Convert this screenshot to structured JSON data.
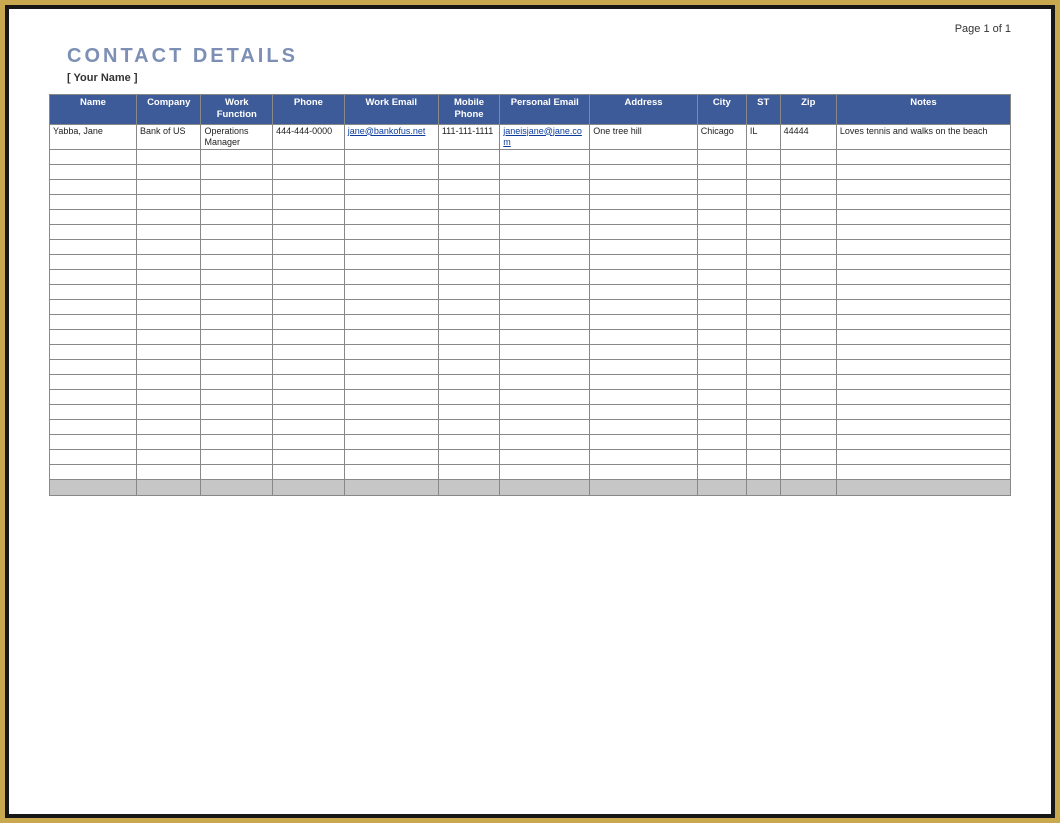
{
  "page_label": "Page 1 of 1",
  "title": "CONTACT DETAILS",
  "subtitle": "[ Your Name ]",
  "columns": {
    "name": "Name",
    "company": "Company",
    "work_function": "Work Function",
    "phone": "Phone",
    "work_email": "Work Email",
    "mobile_phone": "Mobile Phone",
    "personal_email": "Personal Email",
    "address": "Address",
    "city": "City",
    "st": "ST",
    "zip": "Zip",
    "notes": "Notes"
  },
  "rows": [
    {
      "name": "Yabba, Jane",
      "company": "Bank of US",
      "work_function": "Operations Manager",
      "phone": "444-444-0000",
      "work_email": "jane@bankofus.net",
      "mobile_phone": "111-111-1111",
      "personal_email": "janeisjane@jane.com",
      "address": "One tree hill",
      "city": "Chicago",
      "st": "IL",
      "zip": "44444",
      "notes": "Loves tennis and walks on the beach"
    }
  ],
  "empty_row_count": 22
}
